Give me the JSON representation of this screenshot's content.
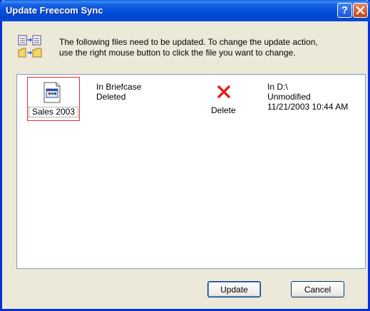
{
  "window": {
    "title": "Update Freecom Sync"
  },
  "info": {
    "icon": "update-files-icon",
    "line1": "The following files need to be updated. To change the update action,",
    "line2": "use the right mouse button to click the file you want to change."
  },
  "file": {
    "name": "Sales 2003",
    "icon": "spreadsheet-file-icon",
    "briefcase_location": "In Briefcase",
    "briefcase_status": "Deleted",
    "action_icon": "delete-x-icon",
    "action": "Delete",
    "dest_location": "In D:\\",
    "dest_status": "Unmodified",
    "dest_modified": "11/21/2003 10:44 AM",
    "action_color": "#e02020"
  },
  "buttons": {
    "update": "Update",
    "cancel": "Cancel"
  },
  "colors": {
    "titlebar": "#0350dc",
    "dialog_bg": "#ece9d8",
    "close_button": "#c44215"
  }
}
